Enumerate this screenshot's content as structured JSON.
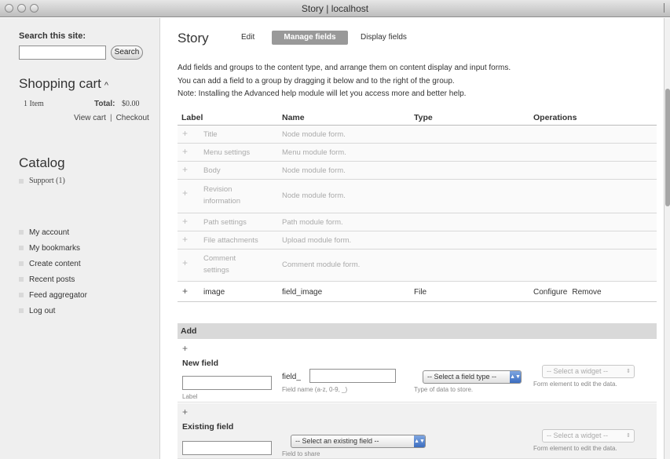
{
  "window": {
    "title": "Story | localhost"
  },
  "sidebar": {
    "search_label": "Search this site:",
    "search_value": "",
    "search_button": "Search",
    "cart": {
      "title": "Shopping cart",
      "caret": "^",
      "items": "1 Item",
      "total_label": "Total:",
      "total_value": "$0.00",
      "view_cart": "View cart",
      "separator": "|",
      "checkout": "Checkout"
    },
    "catalog": {
      "title": "Catalog",
      "item": "Support (1)"
    },
    "nav": [
      "My account",
      "My bookmarks",
      "Create content",
      "Recent posts",
      "Feed aggregator",
      "Log out"
    ]
  },
  "main": {
    "title": "Story",
    "tabs": {
      "edit": "Edit",
      "manage": "Manage fields",
      "display": "Display fields"
    },
    "help": [
      "Add fields and groups to the content type, and arrange them on content display and input forms.",
      "You can add a field to a group by dragging it below and to the right of the group.",
      "Note: Installing the Advanced help module will let you access more and better help."
    ],
    "table": {
      "headers": {
        "label": "Label",
        "name": "Name",
        "type": "Type",
        "operations": "Operations"
      },
      "rows": [
        {
          "label": "Title",
          "name": "Node module form."
        },
        {
          "label": "Menu settings",
          "name": "Menu module form."
        },
        {
          "label": "Body",
          "name": "Node module form."
        },
        {
          "label": "Revision information",
          "name": "Node module form."
        },
        {
          "label": "Path settings",
          "name": "Path module form."
        },
        {
          "label": "File attachments",
          "name": "Upload module form."
        },
        {
          "label": "Comment settings",
          "name": "Comment module form."
        }
      ],
      "image_row": {
        "label": "image",
        "name": "field_image",
        "type": "File",
        "configure": "Configure",
        "remove": "Remove"
      }
    },
    "add": {
      "heading": "Add",
      "new_field": {
        "title": "New field",
        "label_hint": "Label",
        "name_prefix": "field_",
        "name_hint": "Field name (a-z, 0-9, _)",
        "type_select": "-- Select a field type --",
        "type_hint": "Type of data to store.",
        "widget_select": "-- Select a widget --",
        "widget_hint": "Form element to edit the data."
      },
      "existing_field": {
        "title": "Existing field",
        "field_select": "-- Select an existing field --",
        "field_hint": "Field to share",
        "widget_select": "-- Select a widget --",
        "widget_hint": "Form element to edit the data."
      }
    }
  },
  "icons": {
    "drag_handle": "drag-handle-icon",
    "select_arrow": "select-arrow-icon"
  }
}
